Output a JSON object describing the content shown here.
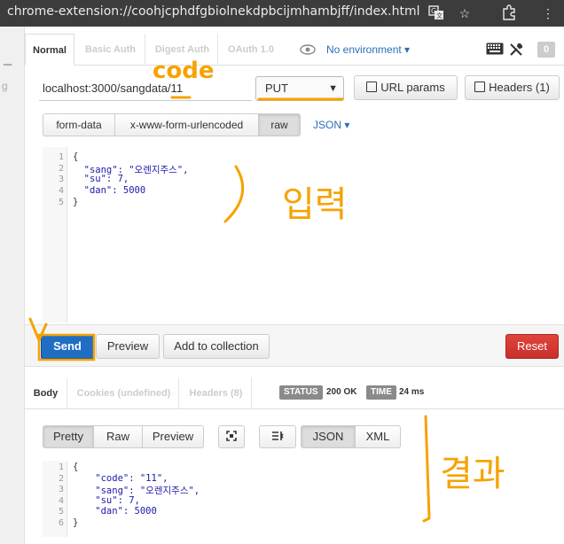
{
  "browser": {
    "url": "chrome-extension://coohjcphdfgbiolnekdpbcijmhambjff/index.html"
  },
  "auth_tabs": [
    "Normal",
    "Basic Auth",
    "Digest Auth",
    "OAuth 1.0"
  ],
  "environment": "No environment",
  "badge_count": "0",
  "request": {
    "url": "localhost:3000/sangdata/11",
    "method": "PUT",
    "url_params_label": "URL params",
    "headers_label": "Headers (1)"
  },
  "body_types": [
    "form-data",
    "x-www-form-urlencoded",
    "raw"
  ],
  "body_format": "JSON",
  "request_body": {
    "line_numbers": [
      "1",
      "2",
      "3",
      "4",
      "5"
    ],
    "lines": [
      "{",
      "  \"sang\": \"오렌지주스\",",
      "  \"su\": 7,",
      "  \"dan\": 5000",
      "}"
    ]
  },
  "actions": {
    "send": "Send",
    "preview": "Preview",
    "add_to_collection": "Add to collection",
    "reset": "Reset"
  },
  "response_tabs": [
    "Body",
    "Cookies (undefined)",
    "Headers (8)"
  ],
  "status": {
    "label": "STATUS",
    "value": "200 OK"
  },
  "time": {
    "label": "TIME",
    "value": "24 ms"
  },
  "response_views": [
    "Pretty",
    "Raw",
    "Preview"
  ],
  "response_formats": [
    "JSON",
    "XML"
  ],
  "response_body": {
    "line_numbers": [
      "1",
      "2",
      "3",
      "4",
      "5",
      "6"
    ],
    "lines": [
      "{",
      "    \"code\": \"11\",",
      "    \"sang\": \"오렌지주스\",",
      "    \"su\": 7,",
      "    \"dan\": 5000",
      "}"
    ]
  },
  "annotations": {
    "code_label": "code",
    "input_label": "입력",
    "result_label": "결과",
    "color": "#f5a300"
  },
  "colors": {
    "accent": "#2a6fb5",
    "send": "#1f6ec4",
    "reset": "#c9302c",
    "annotation": "#f5a300"
  }
}
